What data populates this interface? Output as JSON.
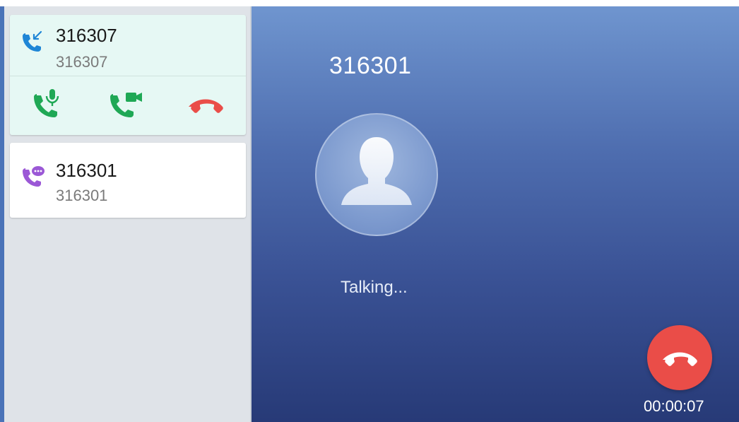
{
  "calls": [
    {
      "name": "316307",
      "number": "316307",
      "direction_icon": "incoming-call-icon",
      "active": true
    },
    {
      "name": "316301",
      "number": "316301",
      "direction_icon": "chat-call-icon",
      "active": false
    }
  ],
  "actions": {
    "audio_answer_icon": "phone-mic-icon",
    "video_answer_icon": "phone-video-icon",
    "reject_icon": "hangup-icon"
  },
  "main": {
    "caller_name": "316301",
    "status": "Talking...",
    "timer": "00:00:07",
    "end_call_icon": "hangup-icon"
  },
  "colors": {
    "green": "#1fa855",
    "red": "#ea4d48",
    "blue": "#1f86d6",
    "purple": "#9b58d6",
    "active_card_bg": "#e6f8f4"
  }
}
